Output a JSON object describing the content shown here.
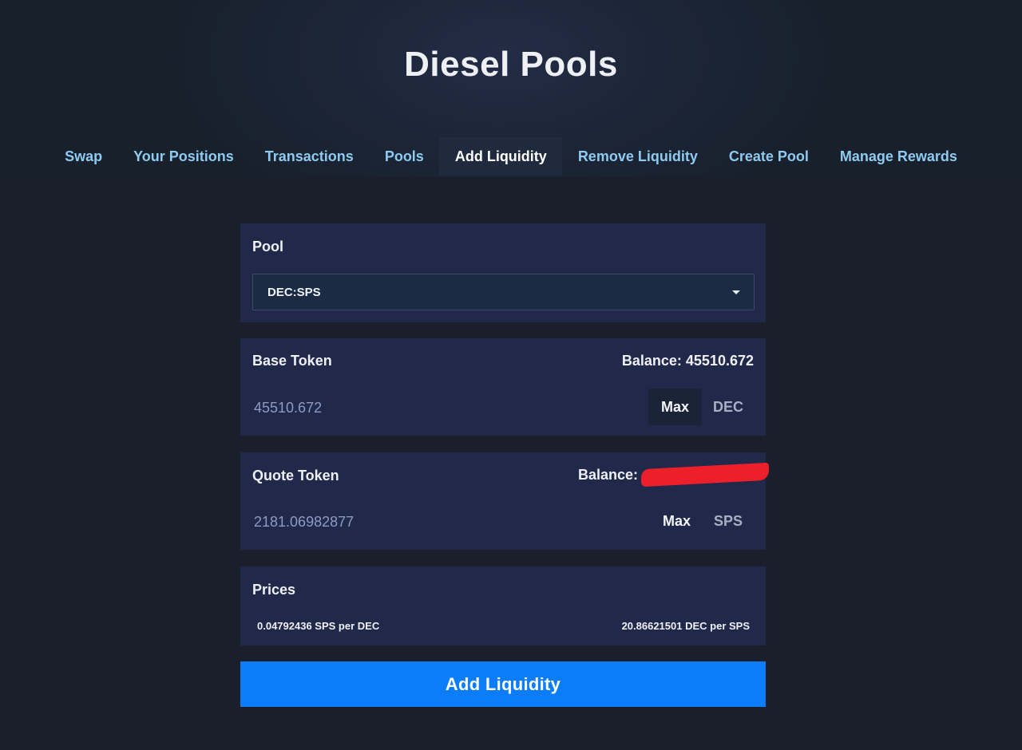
{
  "app": {
    "title": "Diesel Pools"
  },
  "nav": {
    "tabs": [
      {
        "label": "Swap"
      },
      {
        "label": "Your Positions"
      },
      {
        "label": "Transactions"
      },
      {
        "label": "Pools"
      },
      {
        "label": "Add Liquidity",
        "active": true
      },
      {
        "label": "Remove Liquidity"
      },
      {
        "label": "Create Pool"
      },
      {
        "label": "Manage Rewards"
      }
    ]
  },
  "pool": {
    "label": "Pool",
    "selected": "DEC:SPS"
  },
  "base_token": {
    "label": "Base Token",
    "balance_text": "Balance: 45510.672",
    "amount": "45510.672",
    "max_label": "Max",
    "symbol": "DEC"
  },
  "quote_token": {
    "label": "Quote Token",
    "balance_label": "Balance:",
    "balance_redacted": true,
    "amount": "2181.06982877",
    "max_label": "Max",
    "symbol": "SPS"
  },
  "prices": {
    "label": "Prices",
    "left": "0.04792436 SPS per DEC",
    "right": "20.86621501 DEC per SPS"
  },
  "submit": {
    "label": "Add Liquidity"
  },
  "colors": {
    "accent": "#0b7dfb",
    "nav_link": "#8fcaf0",
    "panel": "#20294a",
    "background": "#1b1f2b",
    "redaction": "#ec1f2a"
  }
}
